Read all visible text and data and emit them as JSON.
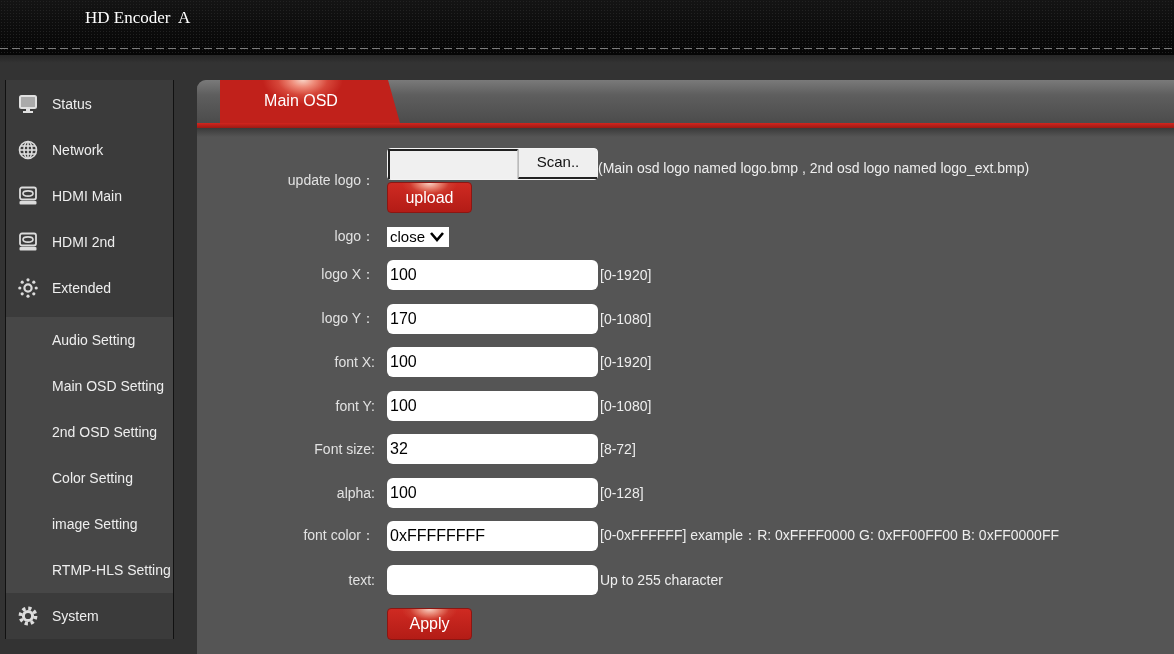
{
  "header": {
    "title": "HD Encoder  A"
  },
  "sidebar": {
    "items": [
      {
        "label": "Status"
      },
      {
        "label": "Network"
      },
      {
        "label": "HDMI Main"
      },
      {
        "label": "HDMI 2nd"
      },
      {
        "label": "Extended",
        "children": [
          {
            "label": "Audio Setting"
          },
          {
            "label": "Main OSD Setting"
          },
          {
            "label": "2nd OSD Setting"
          },
          {
            "label": "Color Setting"
          },
          {
            "label": "image Setting"
          },
          {
            "label": "RTMP-HLS Setting"
          }
        ]
      },
      {
        "label": "System"
      }
    ]
  },
  "tabs": [
    {
      "label": "Main OSD",
      "selected": true
    }
  ],
  "form": {
    "rows": [
      {
        "kind": "file",
        "label": "update logo：",
        "button": "Scan..",
        "action": "upload",
        "note": "(Main osd logo named logo.bmp , 2nd osd logo named logo_ext.bmp)"
      },
      {
        "kind": "select",
        "label": "logo：",
        "value": "close"
      },
      {
        "kind": "input",
        "label": "logo X：",
        "value": "100",
        "hint": "[0-1920]"
      },
      {
        "kind": "input",
        "label": "logo Y：",
        "value": "170",
        "hint": "[0-1080]"
      },
      {
        "kind": "input",
        "label": "font X:",
        "value": "100",
        "hint": "[0-1920]"
      },
      {
        "kind": "input",
        "label": "font Y:",
        "value": "100",
        "hint": "[0-1080]"
      },
      {
        "kind": "input",
        "label": "Font size:",
        "value": "32",
        "hint": "[8-72]"
      },
      {
        "kind": "input",
        "label": "alpha:",
        "value": "100",
        "hint": "[0-128]"
      },
      {
        "kind": "input",
        "label": "font color：",
        "value": "0xFFFFFFFF",
        "hint": "[0-0xFFFFFF] example：R: 0xFFFF0000 G: 0xFF00FF00 B: 0xFF0000FF"
      },
      {
        "kind": "input",
        "label": "text:",
        "hint": "Up to 255 character"
      }
    ],
    "submit": "Apply"
  }
}
